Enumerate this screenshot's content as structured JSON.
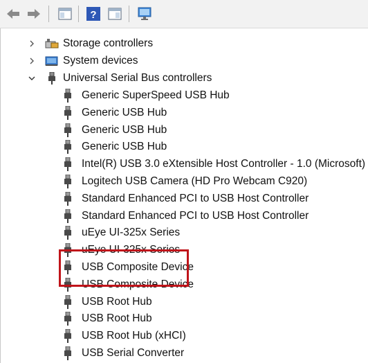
{
  "toolbar": {
    "buttons": [
      {
        "name": "back-button",
        "icon": "arrow-left-icon"
      },
      {
        "name": "forward-button",
        "icon": "arrow-right-icon"
      },
      {
        "name": "show-hide-console-tree-button",
        "icon": "console-tree-icon"
      },
      {
        "name": "help-button",
        "icon": "help-icon",
        "label": "?"
      },
      {
        "name": "properties-button",
        "icon": "properties-icon"
      },
      {
        "name": "scan-hardware-button",
        "icon": "monitor-icon"
      }
    ]
  },
  "tree": {
    "categories": [
      {
        "label": "Storage controllers",
        "expanded": false,
        "icon": "storage-controller-icon"
      },
      {
        "label": "System devices",
        "expanded": false,
        "icon": "system-devices-icon"
      },
      {
        "label": "Universal Serial Bus controllers",
        "expanded": true,
        "icon": "usb-plug-icon"
      }
    ],
    "usb_devices": [
      "Generic SuperSpeed USB Hub",
      "Generic USB Hub",
      "Generic USB Hub",
      "Generic USB Hub",
      "Intel(R) USB 3.0 eXtensible Host Controller - 1.0 (Microsoft)",
      "Logitech USB Camera (HD Pro Webcam C920)",
      "Standard Enhanced PCI to USB Host Controller",
      "Standard Enhanced PCI to USB Host Controller",
      "uEye UI-325x Series",
      "uEye UI-325x Series",
      "USB Composite Device",
      "USB Composite Device",
      "USB Root Hub",
      "USB Root Hub",
      "USB Root Hub (xHCI)",
      "USB Serial Converter"
    ]
  },
  "colors": {
    "highlight_border": "#c0141a",
    "toolbar_bg": "#f2f2f2",
    "arrow_blue": "#2e73c9"
  }
}
